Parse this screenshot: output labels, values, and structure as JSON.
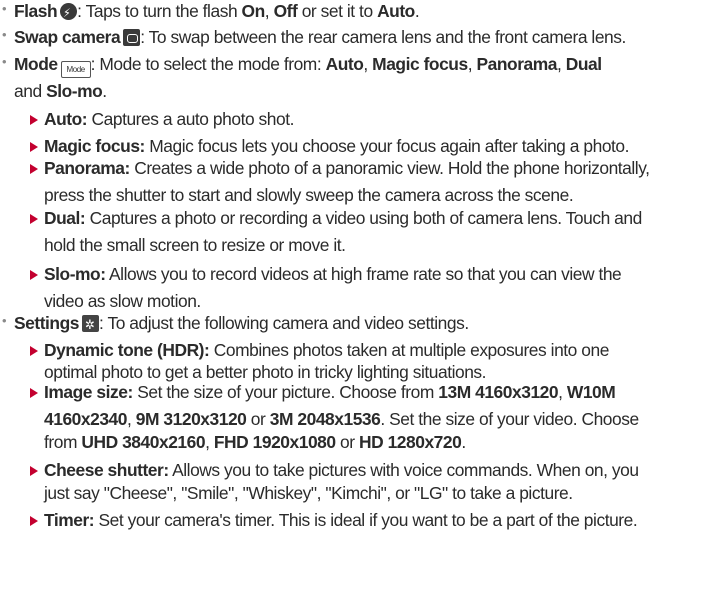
{
  "items": [
    {
      "bold": "Flash",
      "icon": "flash-icon",
      "rest": ": Taps to turn the flash ",
      "tail": [
        {
          "t": "On",
          "b": true
        },
        {
          "t": ", ",
          "b": false
        },
        {
          "t": "Off",
          "b": true
        },
        {
          "t": " or set it to ",
          "b": false
        },
        {
          "t": "Auto",
          "b": true
        },
        {
          "t": ".",
          "b": false
        }
      ]
    },
    {
      "bold": "Swap camera",
      "icon": "swap-camera-icon",
      "rest": ": To swap between the rear camera lens and the front camera lens."
    },
    {
      "bold": "Mode",
      "icon": "mode-icon",
      "icon_text": "Mode",
      "rest": ": Mode to select the mode from: ",
      "tail": [
        {
          "t": "Auto",
          "b": true
        },
        {
          "t": ", ",
          "b": false
        },
        {
          "t": "Magic focus",
          "b": true
        },
        {
          "t": ", ",
          "b": false
        },
        {
          "t": "Panorama",
          "b": true
        },
        {
          "t": ", ",
          "b": false
        },
        {
          "t": "Dual",
          "b": true
        }
      ],
      "line2": [
        {
          "t": "and ",
          "b": false
        },
        {
          "t": "Slo-mo",
          "b": true
        },
        {
          "t": ".",
          "b": false
        }
      ]
    },
    {
      "sub": true,
      "bold": "Auto:",
      "rest": " Captures a auto photo shot."
    },
    {
      "sub": true,
      "bold": "Magic focus:",
      "rest": " Magic focus lets you choose your focus again after taking a photo."
    },
    {
      "sub": true,
      "bold": "Panorama:",
      "rest": " Creates a wide photo of a panoramic view. Hold the phone horizontally,",
      "line2": [
        {
          "t": "press the shutter to start and slowly sweep the camera across the scene.",
          "b": false
        }
      ]
    },
    {
      "sub": true,
      "bold": "Dual:",
      "rest": " Captures a photo or recording a video using both of camera lens. Touch and",
      "line2": [
        {
          "t": "hold the small screen to resize or move it.",
          "b": false
        }
      ]
    },
    {
      "sub": true,
      "bold": "Slo-mo:",
      "rest": " Allows you to record videos at high frame rate so that you can view the",
      "line2": [
        {
          "t": "video as slow motion.",
          "b": false
        }
      ]
    },
    {
      "bold": "Settings",
      "icon": "settings-gear-icon",
      "rest": ": To adjust the following camera and video settings."
    },
    {
      "sub": true,
      "bold": "Dynamic tone (HDR):",
      "rest": " Combines photos taken at multiple exposures into one",
      "line2": [
        {
          "t": "optimal photo to get a better photo in tricky lighting situations.",
          "b": false
        }
      ]
    },
    {
      "sub": true,
      "bold": "Image size:",
      "rest": " Set the size of your picture. Choose from ",
      "tail": [
        {
          "t": "13M 4160x3120",
          "b": true
        },
        {
          "t": ", ",
          "b": false
        },
        {
          "t": "W10M",
          "b": true
        }
      ],
      "line2": [
        {
          "t": "4160x2340",
          "b": true
        },
        {
          "t": ", ",
          "b": false
        },
        {
          "t": "9M 3120x3120",
          "b": true
        },
        {
          "t": " or ",
          "b": false
        },
        {
          "t": "3M 2048x1536",
          "b": true
        },
        {
          "t": ". Set the size of your video. Choose",
          "b": false
        }
      ],
      "line3": [
        {
          "t": "from ",
          "b": false
        },
        {
          "t": "UHD 3840x2160",
          "b": true
        },
        {
          "t": ", ",
          "b": false
        },
        {
          "t": "FHD 1920x1080",
          "b": true
        },
        {
          "t": " or ",
          "b": false
        },
        {
          "t": "HD 1280x720",
          "b": true
        },
        {
          "t": ".",
          "b": false
        }
      ]
    },
    {
      "sub": true,
      "bold": "Cheese shutter:",
      "rest": " Allows you to take pictures with voice commands. When on, you",
      "line2": [
        {
          "t": "just say \"Cheese\", \"Smile\", \"Whiskey\", \"Kimchi\", or \"LG\" to take a picture.",
          "b": false
        }
      ]
    },
    {
      "sub": true,
      "bold": "Timer:",
      "rest": " Set your camera's timer. This is ideal if you want to be a part of the picture."
    }
  ]
}
